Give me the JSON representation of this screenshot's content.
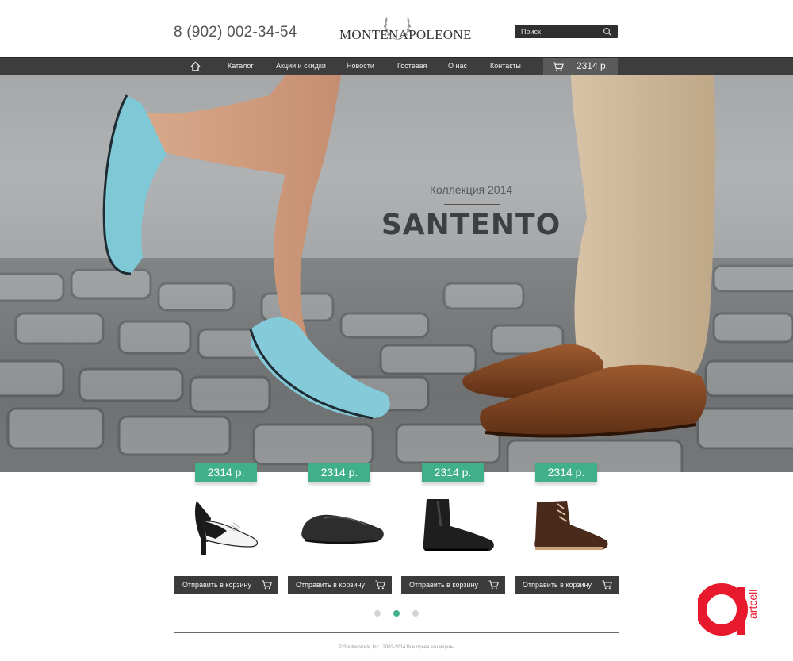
{
  "header": {
    "phone": "8 (902) 002-34-54",
    "logo_text": "MONTENAPOLEONE",
    "search_placeholder": "Поиск"
  },
  "nav": {
    "home_icon": "home-icon",
    "items": [
      "Каталог",
      "Акции и скидки",
      "Новости",
      "Гостевая",
      "О нас",
      "Контакты"
    ],
    "cart_icon": "cart-icon",
    "cart_total": "2314 р."
  },
  "hero": {
    "subtitle": "Коллекция 2014",
    "title": "SANTENTO"
  },
  "products": [
    {
      "price": "2314 р.",
      "button": "Отправить в корзину",
      "image": "saddle-heel-shoe"
    },
    {
      "price": "2314 р.",
      "button": "Отправить в корзину",
      "image": "black-loafer"
    },
    {
      "price": "2314 р.",
      "button": "Отправить в корзину",
      "image": "chelsea-boot"
    },
    {
      "price": "2314 р.",
      "button": "Отправить в корзину",
      "image": "brown-chukka-boot"
    }
  ],
  "pagination": {
    "count": 3,
    "active": 2
  },
  "footer": {
    "copyright": "© Shutterstock, Inc., 2003-2014 Все права защищены"
  },
  "watermark": {
    "text": "artcell"
  },
  "colors": {
    "accent": "#3fb08a",
    "nav_bg": "#3d3d3d",
    "button_bg": "#3b3b3b"
  }
}
